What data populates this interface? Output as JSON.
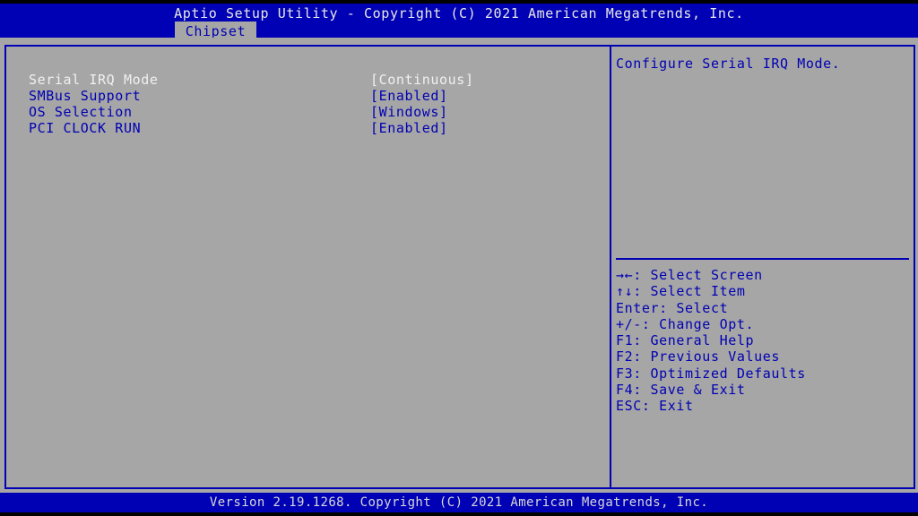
{
  "header": {
    "title": "Aptio Setup Utility - Copyright (C) 2021 American Megatrends, Inc.",
    "active_tab": "Chipset"
  },
  "settings": [
    {
      "label": "Serial IRQ Mode",
      "value": "[Continuous]",
      "selected": true
    },
    {
      "label": "SMBus Support",
      "value": "[Enabled]",
      "selected": false
    },
    {
      "label": "OS Selection",
      "value": "[Windows]",
      "selected": false
    },
    {
      "label": "PCI CLOCK RUN",
      "value": "[Enabled]",
      "selected": false
    }
  ],
  "help": {
    "description": "Configure Serial IRQ Mode.",
    "keys": [
      "→←: Select Screen",
      "↑↓: Select Item",
      "Enter: Select",
      "+/-: Change Opt.",
      "F1: General Help",
      "F2: Previous Values",
      "F3: Optimized Defaults",
      "F4: Save & Exit",
      "ESC: Exit"
    ]
  },
  "footer": {
    "text": "Version 2.19.1268. Copyright (C) 2021 American Megatrends, Inc."
  },
  "colors": {
    "bar_blue": "#0000b4",
    "panel_gray": "#a6a6a6",
    "selected_text": "#f0f0f0"
  }
}
